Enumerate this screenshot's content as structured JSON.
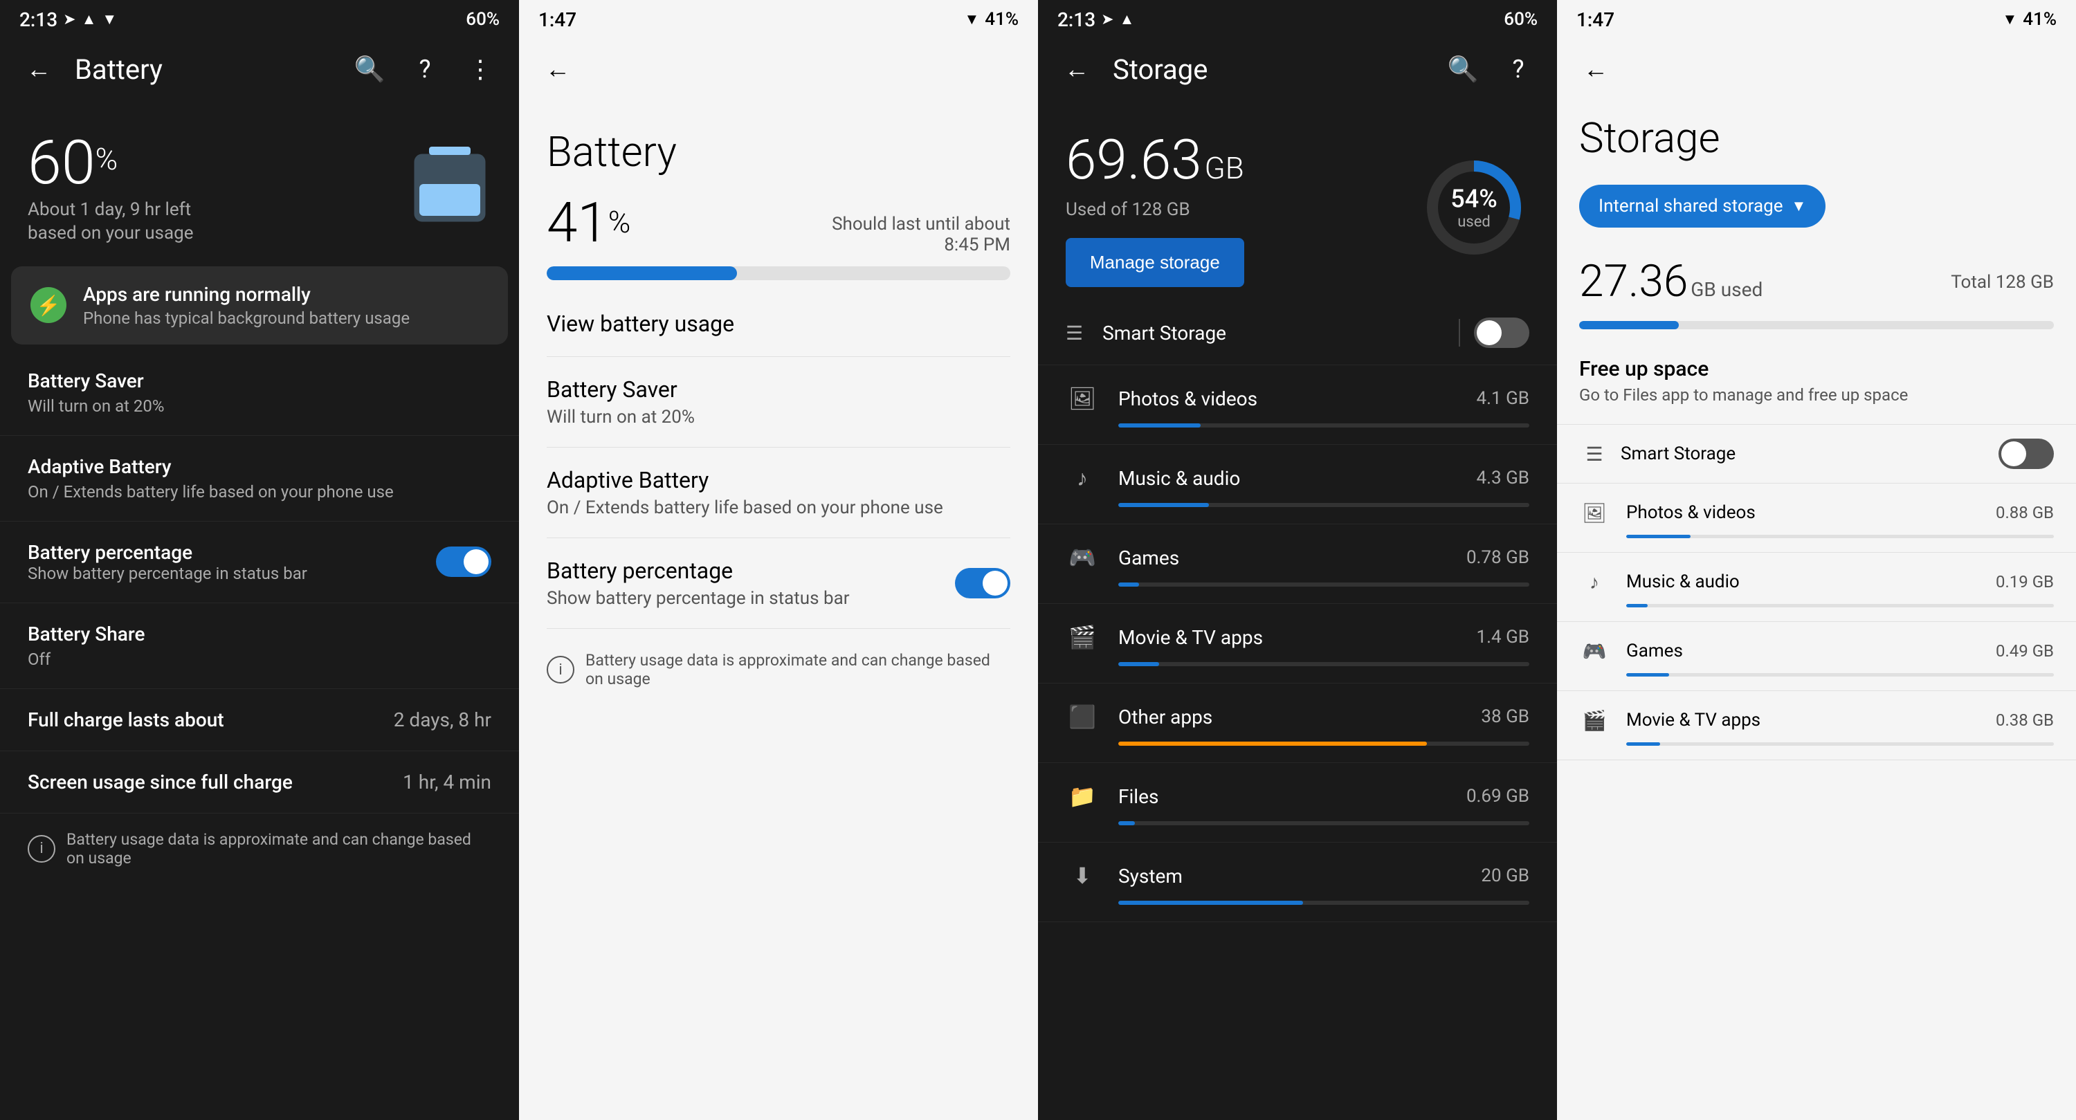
{
  "panels": [
    {
      "id": "panel1",
      "theme": "dark",
      "statusBar": {
        "time": "2:13",
        "icons": [
          "navigation",
          "wifi",
          "battery"
        ],
        "battery": "60%"
      },
      "topBar": {
        "title": "Battery",
        "backIcon": "←",
        "searchIcon": "🔍",
        "helpIcon": "?",
        "menuIcon": "⋮"
      },
      "hero": {
        "percentage": "60",
        "unit": "%",
        "subtitle1": "About 1 day, 9 hr left",
        "subtitle2": "based on your usage"
      },
      "alert": {
        "title": "Apps are running normally",
        "subtitle": "Phone has typical background battery usage"
      },
      "items": [
        {
          "title": "Battery Saver",
          "subtitle": "Will turn on at 20%"
        },
        {
          "title": "Adaptive Battery",
          "subtitle": "On / Extends battery life based on your phone use"
        },
        {
          "title": "Battery percentage",
          "subtitle": "Show battery percentage in status bar",
          "toggle": true,
          "toggleOn": true
        },
        {
          "title": "Battery Share",
          "subtitle": "Off"
        }
      ],
      "rows": [
        {
          "label": "Full charge lasts about",
          "value": "2 days, 8 hr"
        },
        {
          "label": "Screen usage since full charge",
          "value": "1 hr, 4 min"
        }
      ],
      "footer": "Battery usage data is approximate and can change based on usage"
    },
    {
      "id": "panel2",
      "theme": "light",
      "statusBar": {
        "time": "1:47",
        "battery": "41%"
      },
      "topBar": {
        "backIcon": "←"
      },
      "hero": {
        "title": "Battery",
        "percentage": "41",
        "unit": "%",
        "shouldLast": "Should last until about",
        "time": "8:45 PM",
        "progressPct": 41
      },
      "sections": [
        {
          "title": "View battery usage",
          "subtitle": ""
        },
        {
          "title": "Battery Saver",
          "subtitle": "Will turn on at 20%"
        },
        {
          "title": "Adaptive Battery",
          "subtitle": "On / Extends battery life based on your phone use"
        }
      ],
      "toggleRow": {
        "title": "Battery percentage",
        "subtitle": "Show battery percentage in status bar",
        "toggleOn": true
      },
      "footer": "Battery usage data is approximate and can change based on usage"
    },
    {
      "id": "panel3",
      "theme": "dark",
      "statusBar": {
        "time": "2:13",
        "battery": "60%"
      },
      "topBar": {
        "title": "Storage",
        "backIcon": "←",
        "searchIcon": "🔍",
        "helpIcon": "?"
      },
      "hero": {
        "gb": "69.63",
        "gbUnit": "GB",
        "usedOf": "Used of 128 GB",
        "manageBtn": "Manage storage",
        "donutPct": "54%",
        "donutLabel": "used"
      },
      "items": [
        {
          "icon": "📷",
          "name": "Photos & videos",
          "size": "4.1 GB",
          "pct": 20
        },
        {
          "icon": "♪",
          "name": "Music & audio",
          "size": "4.3 GB",
          "pct": 22
        },
        {
          "icon": "🎮",
          "name": "Games",
          "size": "0.78 GB",
          "pct": 5
        },
        {
          "icon": "🎬",
          "name": "Movie & TV apps",
          "size": "1.4 GB",
          "pct": 10
        },
        {
          "icon": "⬛",
          "name": "Other apps",
          "size": "38 GB",
          "pct": 75,
          "orange": true
        },
        {
          "icon": "📁",
          "name": "Files",
          "size": "0.69 GB",
          "pct": 4
        },
        {
          "icon": "⚙",
          "name": "System",
          "size": "20 GB",
          "pct": 45
        }
      ],
      "smartStorage": {
        "name": "Smart Storage",
        "enabled": false
      }
    },
    {
      "id": "panel4",
      "theme": "light",
      "statusBar": {
        "time": "1:47",
        "battery": "41%"
      },
      "topBar": {
        "backIcon": "←"
      },
      "hero": {
        "title": "Storage",
        "chip": "Internal shared storage",
        "gbUsed": "27.36",
        "gbUnit": "GB used",
        "total": "Total 128 GB",
        "progressPct": 21
      },
      "freeUp": {
        "title": "Free up space",
        "subtitle": "Go to Files app to manage and free up space"
      },
      "smartStorage": {
        "name": "Smart Storage",
        "enabled": false
      },
      "items": [
        {
          "icon": "📷",
          "name": "Photos & videos",
          "size": "0.88 GB",
          "pct": 15
        },
        {
          "icon": "♪",
          "name": "Music & audio",
          "size": "0.19 GB",
          "pct": 5
        },
        {
          "icon": "🎮",
          "name": "Games",
          "size": "0.49 GB",
          "pct": 10
        },
        {
          "icon": "🎬",
          "name": "Movie & TV apps",
          "size": "0.38 GB",
          "pct": 8
        }
      ]
    }
  ]
}
